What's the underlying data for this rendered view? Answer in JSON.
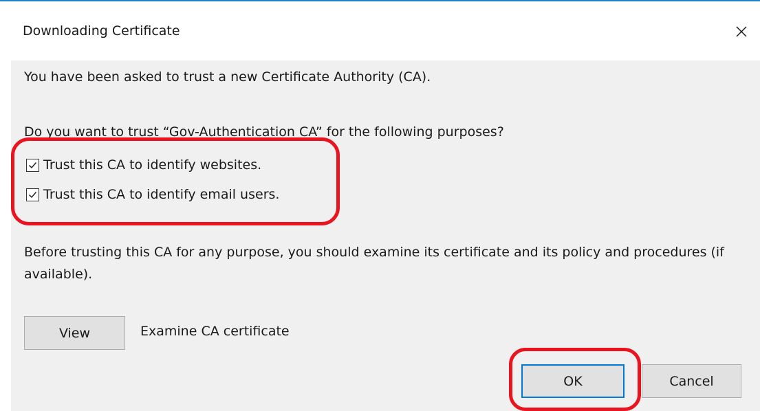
{
  "dialog": {
    "title": "Downloading Certificate",
    "close_icon": "close-icon"
  },
  "content": {
    "intro": "You have been asked to trust a new Certificate Authority (CA).",
    "question": "Do you want to trust “Gov-Authentication CA” for the following purposes?",
    "options": [
      {
        "label": "Trust this CA to identify websites.",
        "checked": true
      },
      {
        "label": "Trust this CA to identify email users.",
        "checked": true
      }
    ],
    "note": "Before trusting this CA for any purpose, you should examine its certificate and its policy and procedures (if available).",
    "view_button": "View",
    "view_description": "Examine CA certificate"
  },
  "buttons": {
    "ok": "OK",
    "cancel": "Cancel"
  },
  "colors": {
    "accent": "#0078d7",
    "annotation": "#e8141f",
    "panel": "#f0f0f0"
  }
}
